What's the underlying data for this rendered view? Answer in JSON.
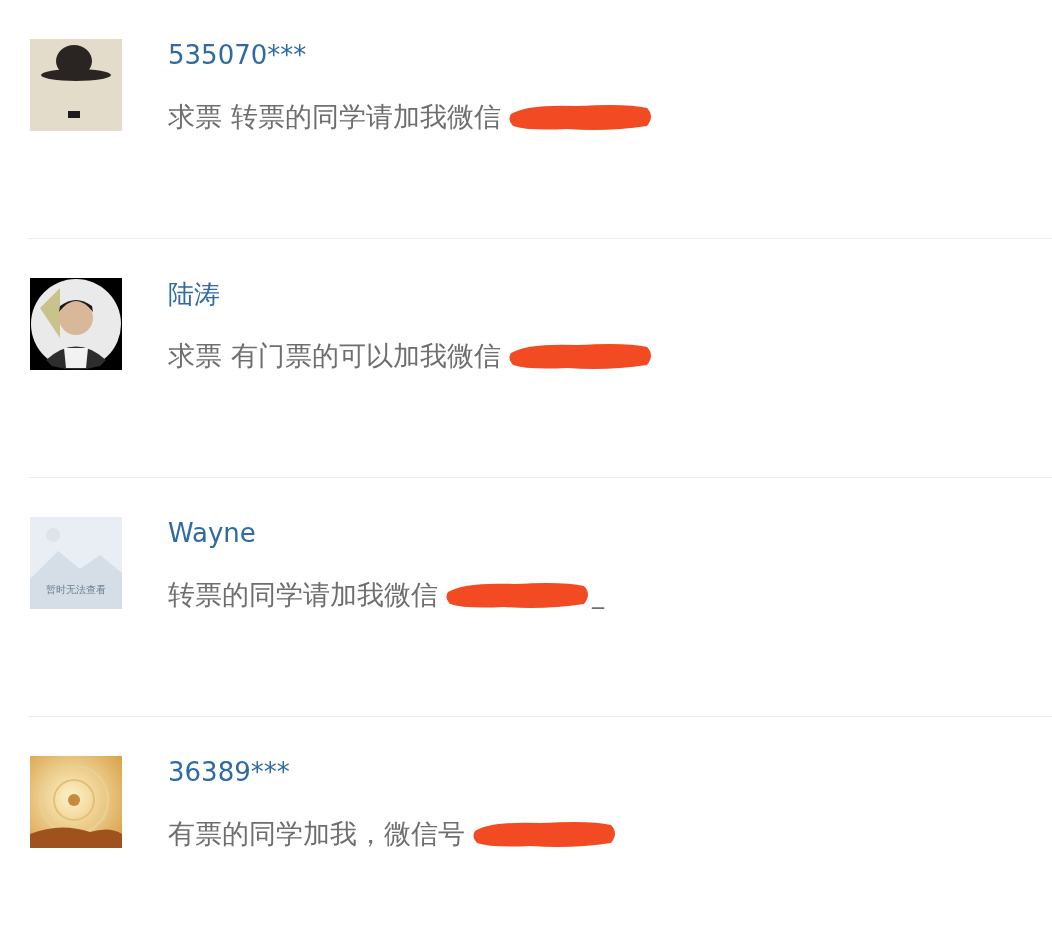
{
  "comments": [
    {
      "avatar": {
        "kind": "hat"
      },
      "name": "535070***",
      "message": "求票 转票的同学请加我微信",
      "redacted": true
    },
    {
      "avatar": {
        "kind": "person"
      },
      "name": "陆涛",
      "message": "求票 有门票的可以加我微信",
      "redacted": true
    },
    {
      "avatar": {
        "kind": "placeholder",
        "caption": "暂时无法查看"
      },
      "name": "Wayne",
      "message": "转票的同学请加我微信",
      "redacted": true,
      "tail": "_"
    },
    {
      "name": "36389***",
      "message": "有票的同学加我，微信号",
      "redacted": true
    }
  ]
}
